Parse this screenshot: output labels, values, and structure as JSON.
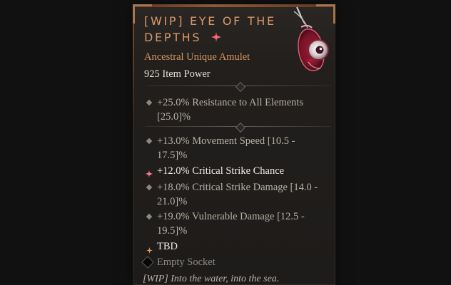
{
  "tooltip": {
    "title": "[WIP] Eye of the Depths",
    "subtitle": "Ancestral Unique Amulet",
    "item_power": "925 Item Power",
    "implicit_affixes": [
      {
        "text": "+25.0% Resistance to All Elements [25.0]%",
        "bullet_icon": "diamond-icon"
      }
    ],
    "affixes": [
      {
        "text": "+13.0% Movement Speed [10.5 - 17.5]%",
        "bullet_icon": "diamond-icon"
      },
      {
        "text": "+12.0% Critical Strike Chance",
        "bullet_icon": "greater-affix-icon"
      },
      {
        "text": "+18.0% Critical Strike Damage [14.0 - 21.0]%",
        "bullet_icon": "diamond-icon"
      },
      {
        "text": "+19.0% Vulnerable Damage [12.5 - 19.5]%",
        "bullet_icon": "diamond-icon"
      }
    ],
    "unique_power": {
      "text": "TBD",
      "icon": "unique-power-icon"
    },
    "socket": {
      "text": "Empty Socket",
      "icon": "socket-icon"
    },
    "flavor_text": "[WIP] Into the water, into the sea.",
    "colors": {
      "background": "#1f1c1a",
      "title": "#d99a6b",
      "subtitle": "#d4955d",
      "body_text": "#b8b0a7",
      "highlight_text": "#f2ede8",
      "accent_red": "#b52a3d"
    },
    "image": {
      "icon": "eye-amulet-icon"
    }
  }
}
